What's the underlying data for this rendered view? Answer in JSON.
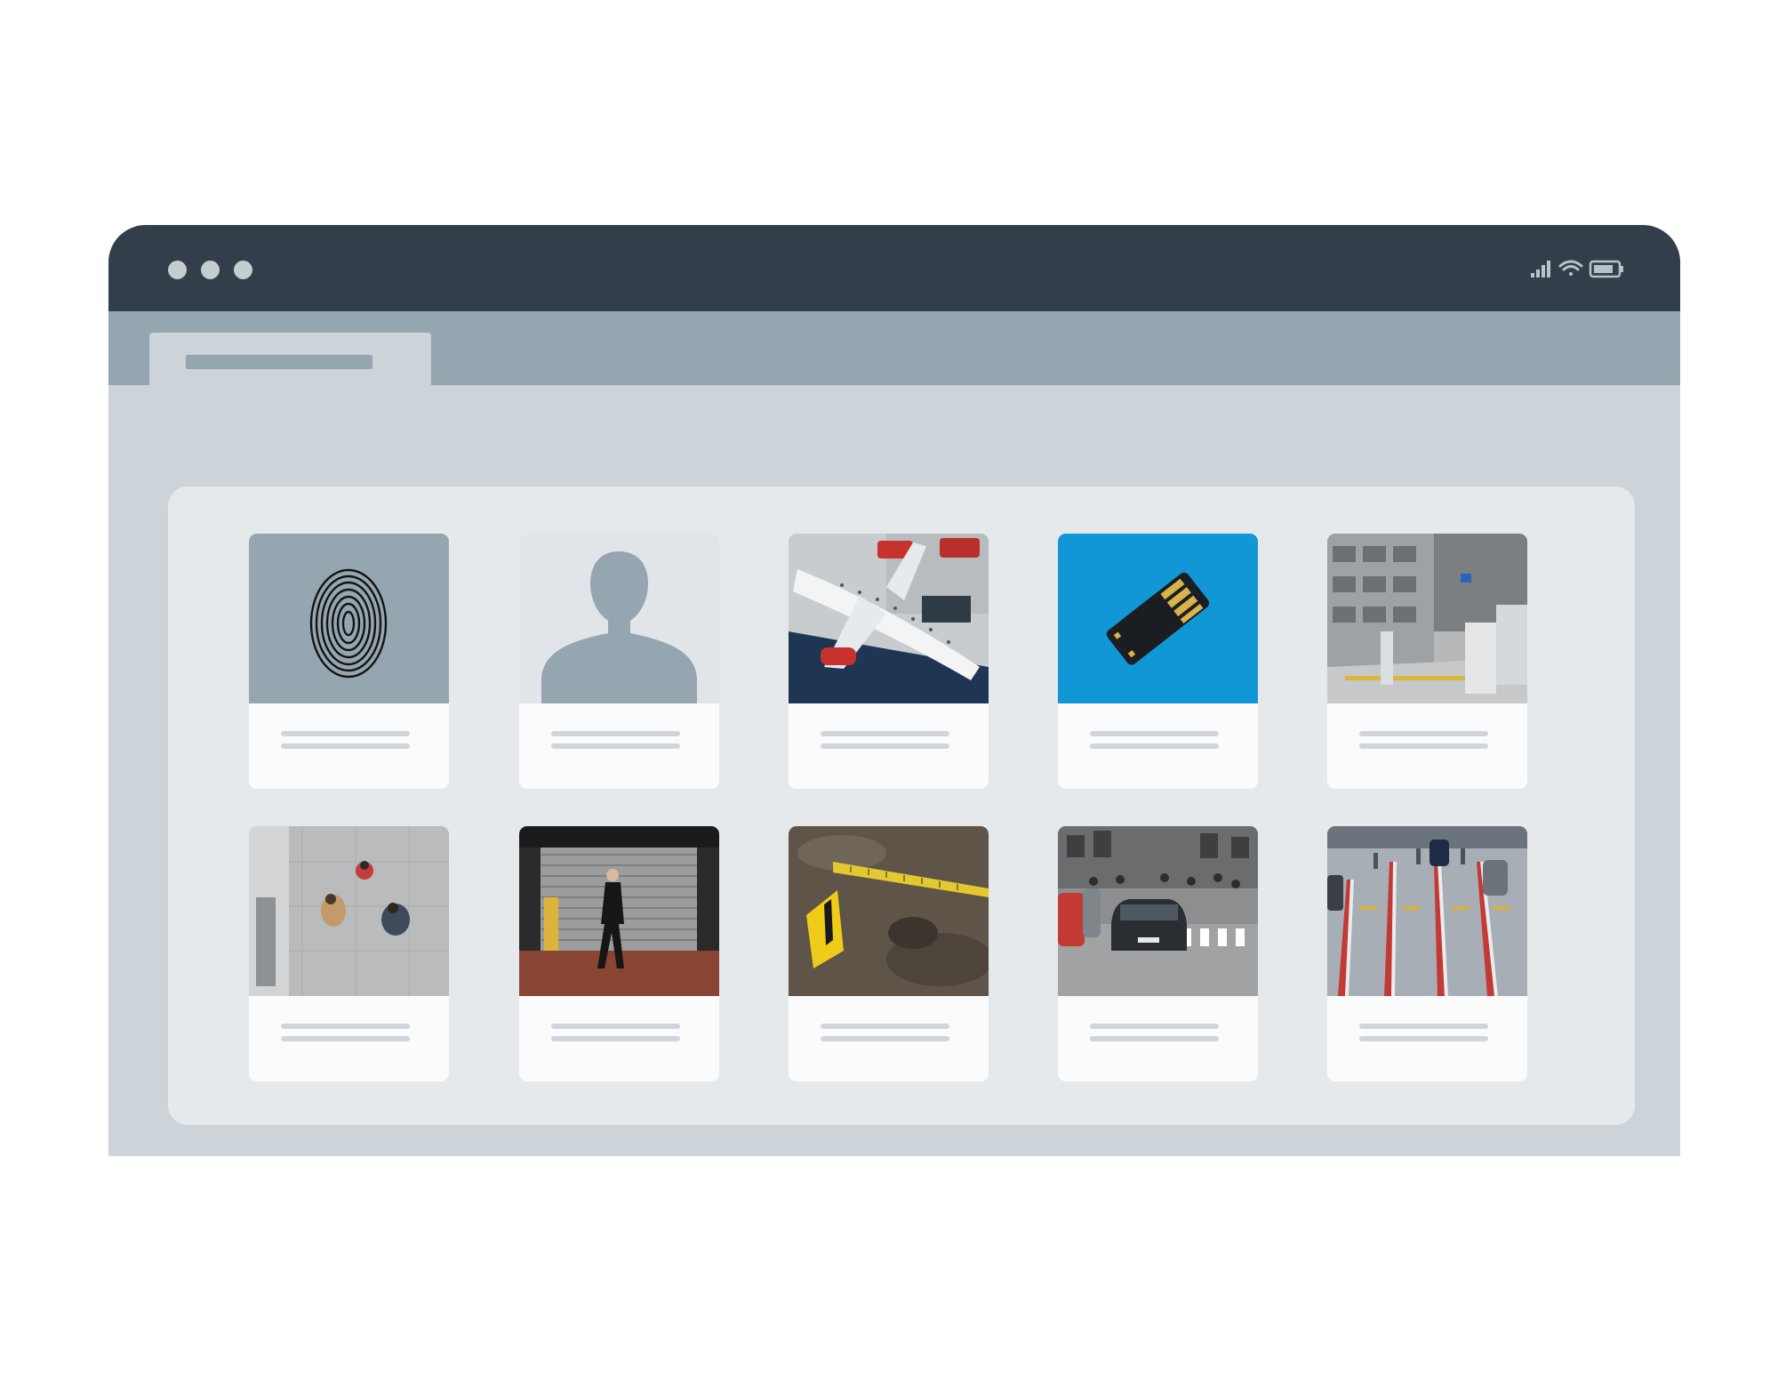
{
  "window": {
    "controls": [
      "window-dot-1",
      "window-dot-2",
      "window-dot-3"
    ],
    "status_icons": [
      "signal-icon",
      "wifi-icon",
      "battery-icon"
    ]
  },
  "tabs": [
    {
      "label": ""
    }
  ],
  "gallery": {
    "cards": [
      {
        "thumbnail": "fingerprint-icon",
        "bg_color": "#96a6b0"
      },
      {
        "thumbnail": "person-silhouette-icon",
        "bg_color": "#e1e5e9"
      },
      {
        "thumbnail": "airplane-aerial-photo"
      },
      {
        "thumbnail": "usb-chip-icon",
        "bg_color": "#1197d6"
      },
      {
        "thumbnail": "parking-garage-photo"
      },
      {
        "thumbnail": "handshake-aerial-photo"
      },
      {
        "thumbnail": "man-walking-photo"
      },
      {
        "thumbnail": "evidence-marker-photo"
      },
      {
        "thumbnail": "street-traffic-photo"
      },
      {
        "thumbnail": "parking-lanes-photo"
      }
    ]
  }
}
